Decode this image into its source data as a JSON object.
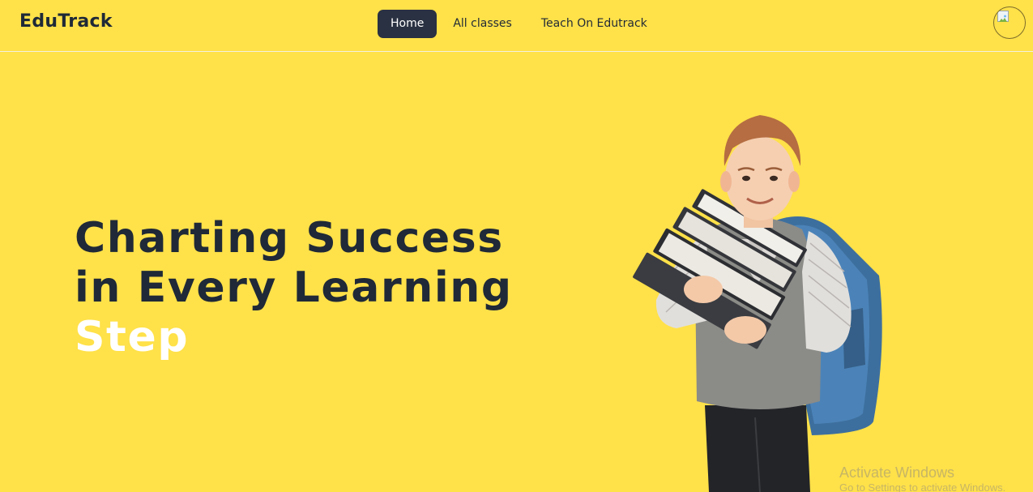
{
  "header": {
    "brand": "EduTrack",
    "nav": [
      {
        "label": "Home",
        "active": true
      },
      {
        "label": "All classes",
        "active": false
      },
      {
        "label": "Teach On Edutrack",
        "active": false
      }
    ],
    "avatar_icon": "broken-image-icon"
  },
  "hero": {
    "title_line1": "Charting Success",
    "title_line2": "in Every Learning",
    "title_accent": "Step",
    "image": "boy-with-books-and-backpack"
  },
  "os_overlay": {
    "line1": "Activate Windows",
    "line2": "Go to Settings to activate Windows."
  },
  "colors": {
    "background": "#ffe149",
    "text_dark": "#1f2937",
    "active_nav": "#2a3142",
    "accent_text": "#ffffff"
  }
}
